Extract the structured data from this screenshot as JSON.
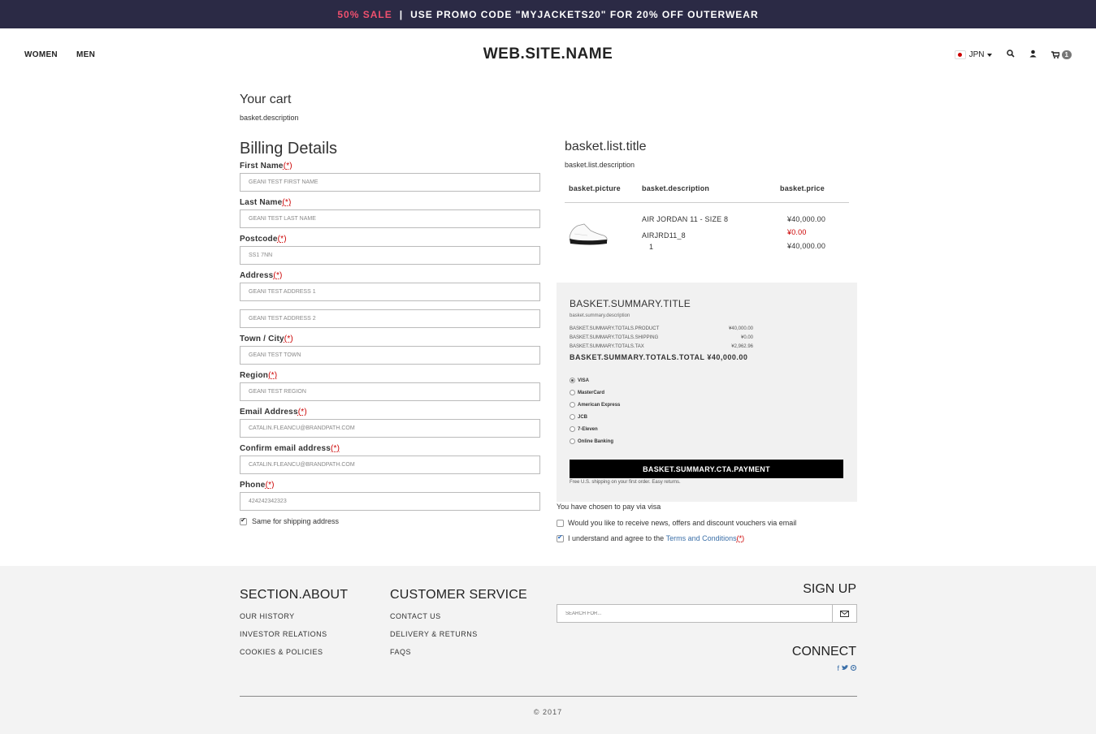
{
  "promo": {
    "sale": "50% SALE",
    "separator": "|",
    "message": "USE PROMO CODE \"MYJACKETS20\" FOR 20% OFF OUTERWEAR"
  },
  "nav": {
    "women": "WOMEN",
    "men": "MEN",
    "logo": "WEB.SITE.NAME",
    "currency": "JPN",
    "cart_count": "1"
  },
  "cart": {
    "title": "Your cart",
    "description": "basket.description"
  },
  "billing": {
    "title": "Billing Details",
    "required_mark": "(*)",
    "fields": [
      {
        "label": "First Name",
        "value": "GEANI TEST FIRST NAME"
      },
      {
        "label": "Last Name",
        "value": "GEANI TEST LAST NAME"
      },
      {
        "label": "Postcode",
        "value": "SS1 7NN"
      },
      {
        "label": "Address",
        "value": "GEANI TEST ADDRESS 1",
        "value2": "GEANI TEST ADDRESS 2"
      },
      {
        "label": "Town / City",
        "value": "GEANI TEST TOWN"
      },
      {
        "label": "Region",
        "value": "GEANI TEST REGION"
      },
      {
        "label": "Email Address",
        "value": "CATALIN.FLEANCU@BRANDPATH.COM"
      },
      {
        "label": "Confirm email address",
        "value": "CATALIN.FLEANCU@BRANDPATH.COM"
      },
      {
        "label": "Phone",
        "value": "424242342323"
      }
    ],
    "same_shipping": "Same for shipping address"
  },
  "basket": {
    "title": "basket.list.title",
    "description": "basket.list.description",
    "headers": {
      "picture": "basket.picture",
      "description": "basket.description",
      "price": "basket.price"
    },
    "item": {
      "name": "AIR JORDAN 11 - SIZE 8",
      "sku": "AIRJRD11_8",
      "qty": "1",
      "price": "¥40,000.00",
      "discount": "¥0.00",
      "total": "¥40,000.00"
    }
  },
  "summary": {
    "title": "BASKET.SUMMARY.TITLE",
    "description": "basket.summary.description",
    "rows": [
      {
        "label": "BASKET.SUMMARY.TOTALS.PRODUCT",
        "value": "¥40,000.00"
      },
      {
        "label": "BASKET.SUMMARY.TOTALS.SHIPPING",
        "value": "¥0.00"
      },
      {
        "label": "BASKET.SUMMARY.TOTALS.TAX",
        "value": "¥2,962.96"
      }
    ],
    "total_label": "BASKET.SUMMARY.TOTALS.TOTAL",
    "total_value": "¥40,000.00",
    "payment_methods": [
      "VISA",
      "MasterCard",
      "American Express",
      "JCB",
      "7-Eleven",
      "Online Banking"
    ],
    "selected_payment": "VISA",
    "cta": "BASKET.SUMMARY.CTA.PAYMENT",
    "shipping_note": "Free U.S. shipping on your first order. Easy returns."
  },
  "checkout": {
    "chosen": "You have chosen to pay via visa",
    "newsletter": "Would you like to receive news, offers and discount vouchers via email",
    "terms_prefix": "I understand and agree to the",
    "terms_link": "Terms and Conditions",
    "terms_req": "(*)"
  },
  "footer": {
    "about_title": "SECTION.ABOUT",
    "about_links": [
      "OUR HISTORY",
      "INVESTOR RELATIONS",
      "COOKIES & POLICIES"
    ],
    "service_title": "CUSTOMER SERVICE",
    "service_links": [
      "CONTACT US",
      "DELIVERY & RETURNS",
      "FAQS"
    ],
    "signup_title": "SIGN UP",
    "search_placeholder": "SEARCH FOR...",
    "connect_title": "CONNECT",
    "copyright": "© 2017"
  }
}
